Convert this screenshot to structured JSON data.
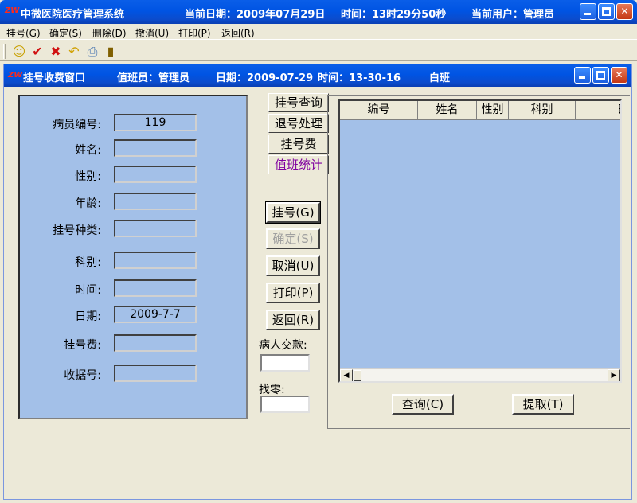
{
  "titlebar": {
    "app_title": "中微医院医疗管理系统",
    "date_label": "当前日期：2009年07月29日",
    "time_label": "时间：13时29分50秒",
    "user_label": "当前用户：管理员"
  },
  "menu": [
    "挂号(G)",
    "确定(S)",
    "删除(D)",
    "撤消(U)",
    "打印(P)",
    "返回(R)"
  ],
  "toolbar_icons": [
    "smiley-icon",
    "check-icon",
    "delete-icon",
    "undo-icon",
    "print-icon",
    "exit-icon"
  ],
  "child": {
    "title": "挂号收费窗口",
    "operator": "值班员：管理员",
    "date": "日期：2009-07-29",
    "time": "时间：13-30-16",
    "shift": "白班"
  },
  "form": {
    "labels": [
      "病员编号:",
      "姓名:",
      "性别:",
      "年龄:",
      "挂号种类:",
      "科别:",
      "时间:",
      "日期:",
      "挂号费:",
      "收据号:"
    ],
    "values": [
      "119",
      "",
      "",
      "",
      "",
      "",
      "",
      "2009-7-7",
      "",
      ""
    ]
  },
  "tabs": [
    "挂号查询",
    "退号处理",
    "挂号费",
    "值班统计"
  ],
  "buttons": {
    "register": "挂号(G)",
    "confirm": "确定(S)",
    "cancel": "取消(U)",
    "print": "打印(P)",
    "back": "返回(R)"
  },
  "payment": {
    "paid_label": "病人交款:",
    "change_label": "找零:"
  },
  "grid": {
    "columns": [
      "编号",
      "姓名",
      "性别",
      "科别",
      "日期"
    ]
  },
  "grid_buttons": {
    "query": "查询(C)",
    "fetch": "提取(T)"
  },
  "colors": {
    "titlebar": "#0054e3",
    "panel": "#a3c0e8",
    "face": "#ece9d8"
  }
}
